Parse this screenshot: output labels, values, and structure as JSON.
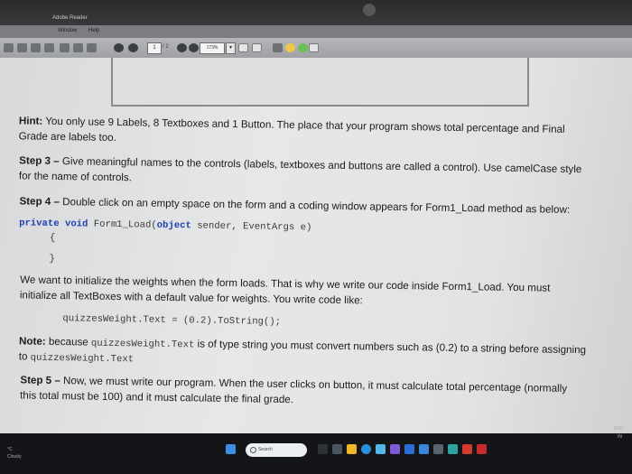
{
  "window": {
    "app_title": "Adobe Reader"
  },
  "menu": {
    "items": [
      "Window",
      "Help"
    ]
  },
  "toolbar": {
    "page_number": "1",
    "page_total": "/ 2",
    "zoom": "173%",
    "zoom_caret": "▾"
  },
  "document": {
    "hint_label": "Hint:",
    "hint_line1": " You only use 9 Labels, 8 Textboxes and 1 Button. The place that your program shows total percentage and Final",
    "hint_line2": "Grade are labels too.",
    "step3_label": "Step 3 –",
    "step3_line1": " Give meaningful names to the controls (labels, textboxes and buttons are called a control). Use camelCase style",
    "step3_line2": "for the name of controls.",
    "step4_label": "Step 4 –",
    "step4_line1": " Double click on an empty space on the form and a coding window appears for Form1_Load method as below:",
    "code_private": "private",
    "code_void": "void",
    "code_method": " Form1_Load(",
    "code_object": "object",
    "code_params": " sender, EventArgs e)",
    "code_open": "{",
    "code_close": "}",
    "para_line1": "We want to initialize the weights when the form loads. That is why we write our code inside Form1_Load. You must",
    "para_line2": "initialize all TextBoxes with a default value for weights. You write code like:",
    "code_example": "quizzesWeight.Text = (0.2).ToString();",
    "note_label": "Note:",
    "note_line1a": " because ",
    "note_code1": "quizzesWeight.Text",
    "note_line1b": " is of type string you must convert numbers such as (0.2) to a string before assigning",
    "note_line2a": "to ",
    "note_code2": "quizzesWeight.Text",
    "step5_label": "Step 5 –",
    "step5_line1": " Now, we must write our program. When the user clicks on button, it must calculate total percentage (normally",
    "step5_line2": "this total must be 100) and it must calculate the final grade."
  },
  "taskbar": {
    "search_placeholder": "Search",
    "lang_top": "ENG",
    "lang_bottom": "IN",
    "left_text_1": "°C",
    "left_text_2": "Cloudy"
  }
}
